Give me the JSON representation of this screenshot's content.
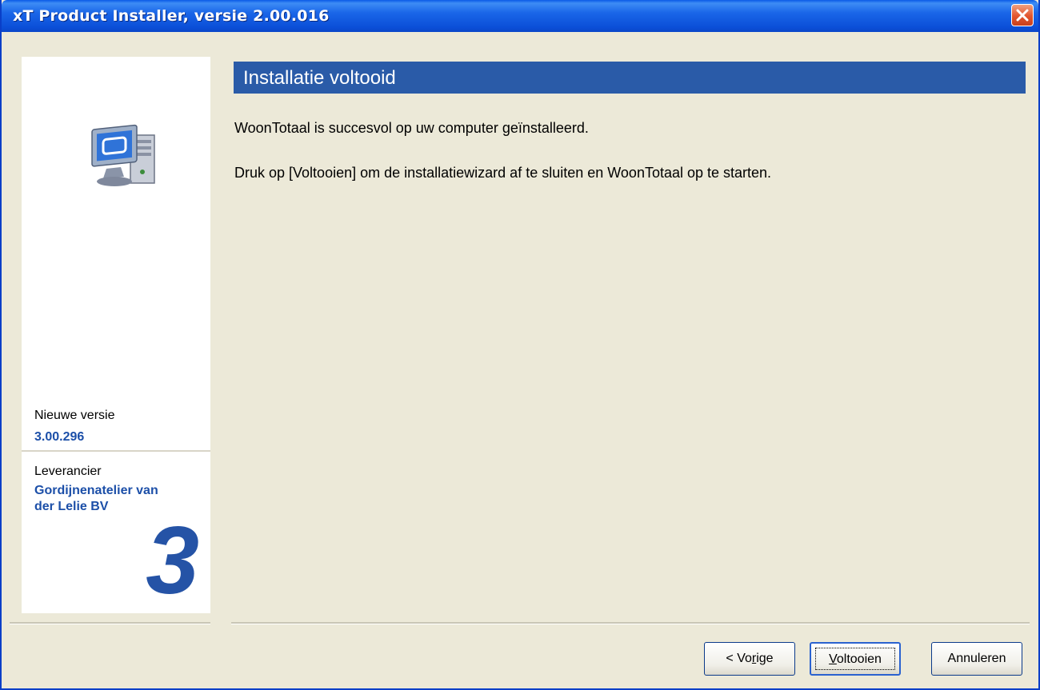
{
  "window": {
    "title": "xT Product Installer, versie 2.00.016"
  },
  "header": {
    "title": "Installatie voltooid"
  },
  "messages": {
    "line1": "WoonTotaal is succesvol op uw computer geïnstalleerd.",
    "line2": "Druk op [Voltooien] om de installatiewizard af te sluiten en WoonTotaal op te starten."
  },
  "sidebar": {
    "version_label": "Nieuwe versie",
    "version_value": "3.00.296",
    "supplier_label": "Leverancier",
    "supplier_value_line1": "Gordijnenatelier van",
    "supplier_value_line2": "der Lelie BV",
    "step_number": "3",
    "icon": "computer-icon"
  },
  "buttons": {
    "previous_prefix": "< Vo",
    "previous_accel": "r",
    "previous_suffix": "ige",
    "finish_accel": "V",
    "finish_suffix": "oltooien",
    "cancel": "Annuleren"
  },
  "colors": {
    "header": "#2a5ba8",
    "accent_text": "#1c4fa8",
    "titlebar": "#0b4fd8",
    "close": "#e2552e"
  }
}
